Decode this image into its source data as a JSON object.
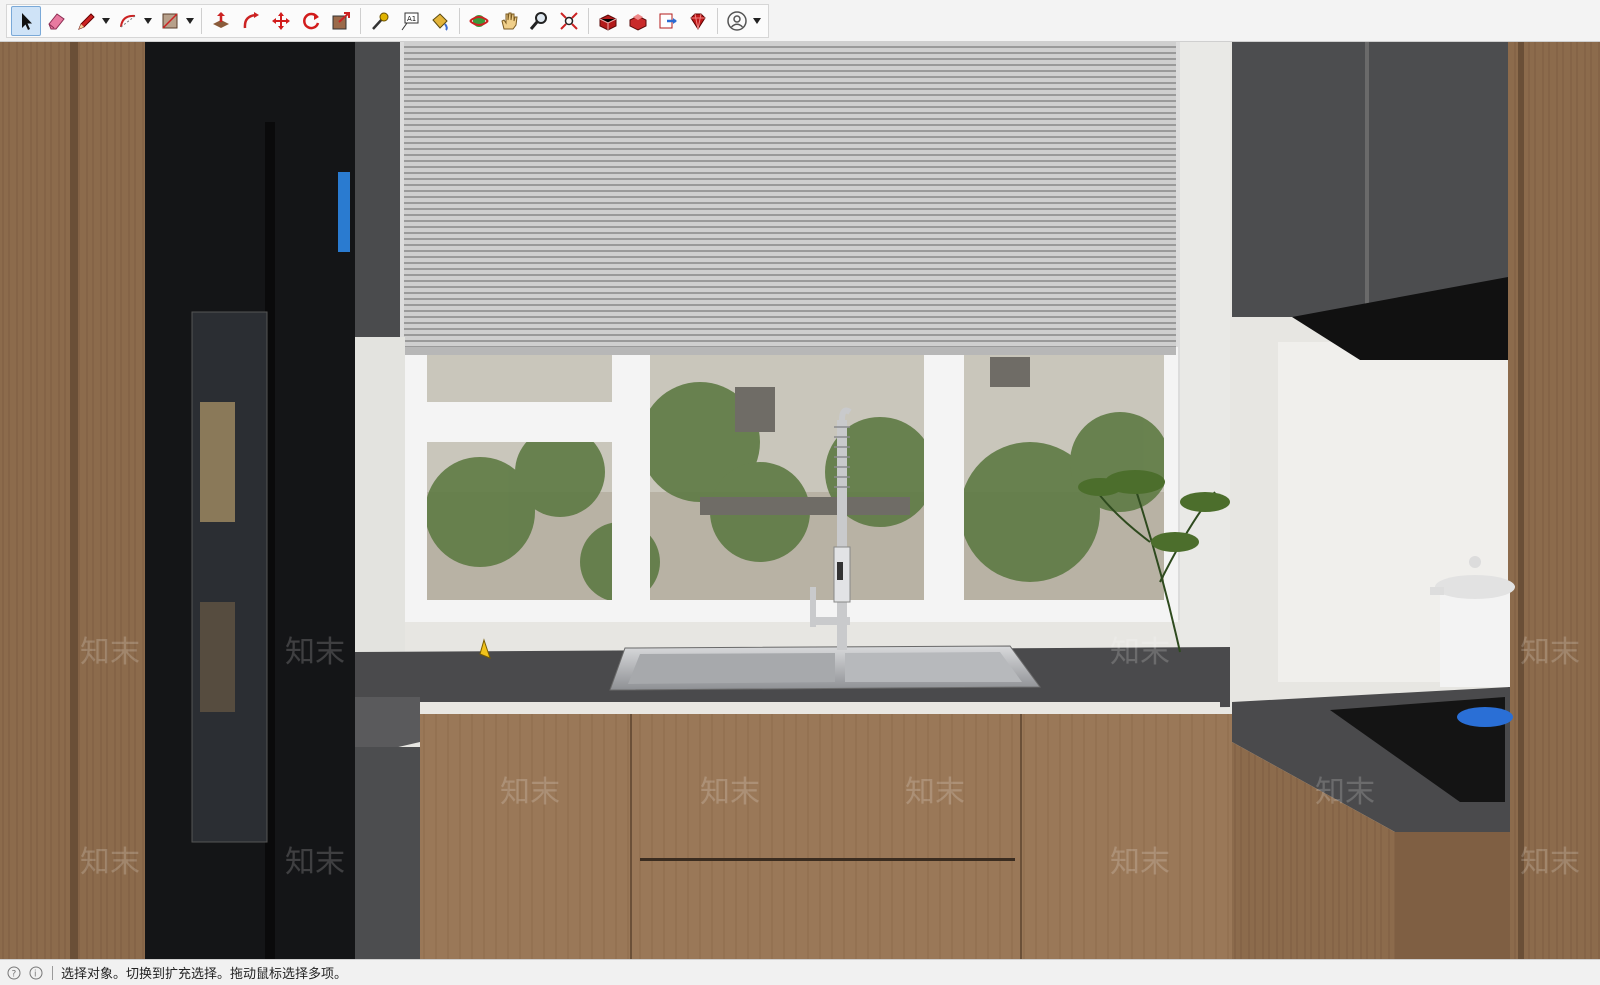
{
  "toolbar": {
    "tools": [
      {
        "id": "select",
        "icon": "arrow-select-icon",
        "active": true
      },
      {
        "id": "eraser",
        "icon": "eraser-icon"
      },
      {
        "id": "line",
        "icon": "pencil-icon",
        "dropdown": true
      },
      {
        "id": "arc",
        "icon": "arc-icon",
        "dropdown": true
      },
      {
        "id": "rectangle",
        "icon": "rectangle-icon",
        "dropdown": true
      },
      {
        "id": "push-pull",
        "icon": "push-pull-icon"
      },
      {
        "id": "offset",
        "icon": "offset-icon"
      },
      {
        "id": "move",
        "icon": "move-icon"
      },
      {
        "id": "rotate",
        "icon": "rotate-icon"
      },
      {
        "id": "scale",
        "icon": "scale-icon"
      },
      {
        "id": "tape-measure",
        "icon": "tape-measure-icon"
      },
      {
        "id": "text",
        "icon": "text-icon"
      },
      {
        "id": "paint-bucket",
        "icon": "paint-bucket-icon"
      },
      {
        "id": "orbit",
        "icon": "orbit-icon"
      },
      {
        "id": "pan",
        "icon": "pan-hand-icon"
      },
      {
        "id": "zoom",
        "icon": "zoom-icon"
      },
      {
        "id": "zoom-extents",
        "icon": "zoom-extents-icon"
      },
      {
        "id": "3d-warehouse",
        "icon": "warehouse-icon"
      },
      {
        "id": "extension-warehouse",
        "icon": "extension-warehouse-icon"
      },
      {
        "id": "send-to-layout",
        "icon": "layout-icon"
      },
      {
        "id": "extension-manager",
        "icon": "ruby-gem-icon"
      },
      {
        "id": "account",
        "icon": "account-icon",
        "dropdown": true
      }
    ]
  },
  "status": {
    "message": "选择对象。切换到扩充选择。拖动鼠标选择多项。"
  },
  "watermark": {
    "text": "知末"
  },
  "colors": {
    "wood": "#8a6a4c",
    "countertop": "#4a4a4c",
    "fridge": "#141517",
    "blind": "#c9c9c9",
    "wall": "#e9e9e6"
  }
}
